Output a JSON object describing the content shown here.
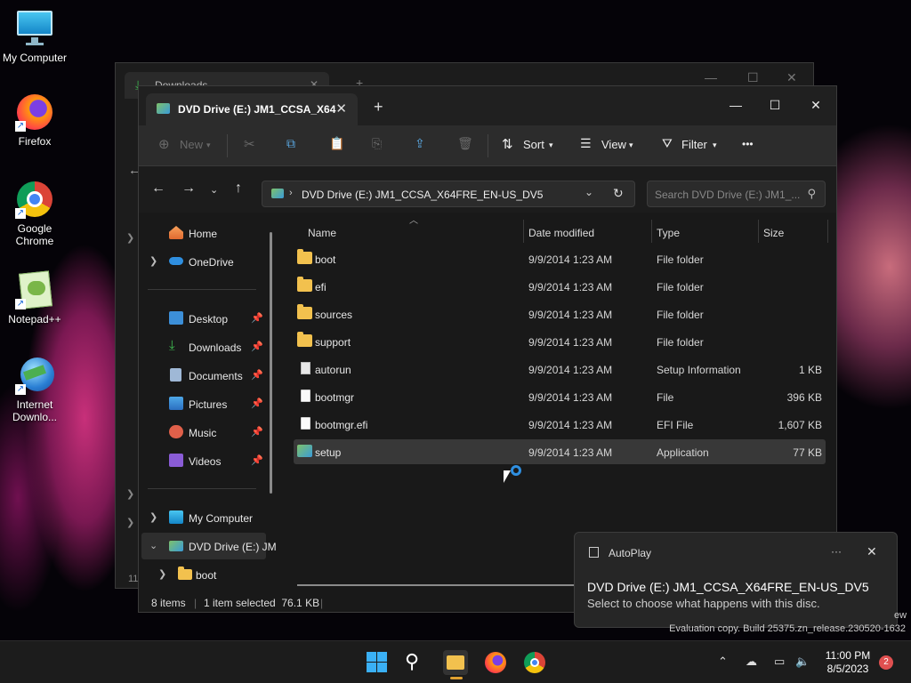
{
  "desktop": {
    "icons": [
      {
        "label": "My Computer"
      },
      {
        "label": "Firefox"
      },
      {
        "label": "Google Chrome"
      },
      {
        "label": "Notepad++"
      },
      {
        "label": "Internet Downlo..."
      }
    ],
    "watermark_suffix": "ew",
    "evaluation_text": "Evaluation copy. Build 25375.zn_release.230520-1632"
  },
  "back_window": {
    "tab_title": "Downloads",
    "tree_partial": "11"
  },
  "window": {
    "tab_title": "DVD Drive (E:) JM1_CCSA_X64",
    "colors": {
      "accent": "#60cdff",
      "folder": "#f2c14e",
      "selection": "#383838"
    }
  },
  "toolbar": {
    "new_label": "New",
    "sort_label": "Sort",
    "view_label": "View",
    "filter_label": "Filter",
    "more_label": "•••"
  },
  "address": {
    "path": "DVD Drive (E:) JM1_CCSA_X64FRE_EN-US_DV5",
    "search_placeholder": "Search DVD Drive (E:) JM1_..."
  },
  "sidebar": {
    "home": "Home",
    "onedrive": "OneDrive",
    "quick": [
      {
        "label": "Desktop"
      },
      {
        "label": "Downloads"
      },
      {
        "label": "Documents"
      },
      {
        "label": "Pictures"
      },
      {
        "label": "Music"
      },
      {
        "label": "Videos"
      }
    ],
    "my_computer": "My Computer",
    "dvd": "DVD Drive (E:) JM",
    "boot": "boot"
  },
  "columns": {
    "name": "Name",
    "date": "Date modified",
    "type": "Type",
    "size": "Size"
  },
  "files": [
    {
      "name": "boot",
      "date": "9/9/2014 1:23 AM",
      "type": "File folder",
      "size": ""
    },
    {
      "name": "efi",
      "date": "9/9/2014 1:23 AM",
      "type": "File folder",
      "size": ""
    },
    {
      "name": "sources",
      "date": "9/9/2014 1:23 AM",
      "type": "File folder",
      "size": ""
    },
    {
      "name": "support",
      "date": "9/9/2014 1:23 AM",
      "type": "File folder",
      "size": ""
    },
    {
      "name": "autorun",
      "date": "9/9/2014 1:23 AM",
      "type": "Setup Information",
      "size": "1 KB"
    },
    {
      "name": "bootmgr",
      "date": "9/9/2014 1:23 AM",
      "type": "File",
      "size": "396 KB"
    },
    {
      "name": "bootmgr.efi",
      "date": "9/9/2014 1:23 AM",
      "type": "EFI File",
      "size": "1,607 KB"
    },
    {
      "name": "setup",
      "date": "9/9/2014 1:23 AM",
      "type": "Application",
      "size": "77 KB"
    }
  ],
  "status": {
    "items": "8 items",
    "selected": "1 item selected  76.1 KB"
  },
  "toast": {
    "app": "AutoPlay",
    "more": "···",
    "title": "DVD Drive (E:) JM1_CCSA_X64FRE_EN-US_DV5",
    "message": "Select to choose what happens with this disc."
  },
  "taskbar": {
    "time": "11:00 PM",
    "date": "8/5/2023",
    "notifications": "2"
  }
}
